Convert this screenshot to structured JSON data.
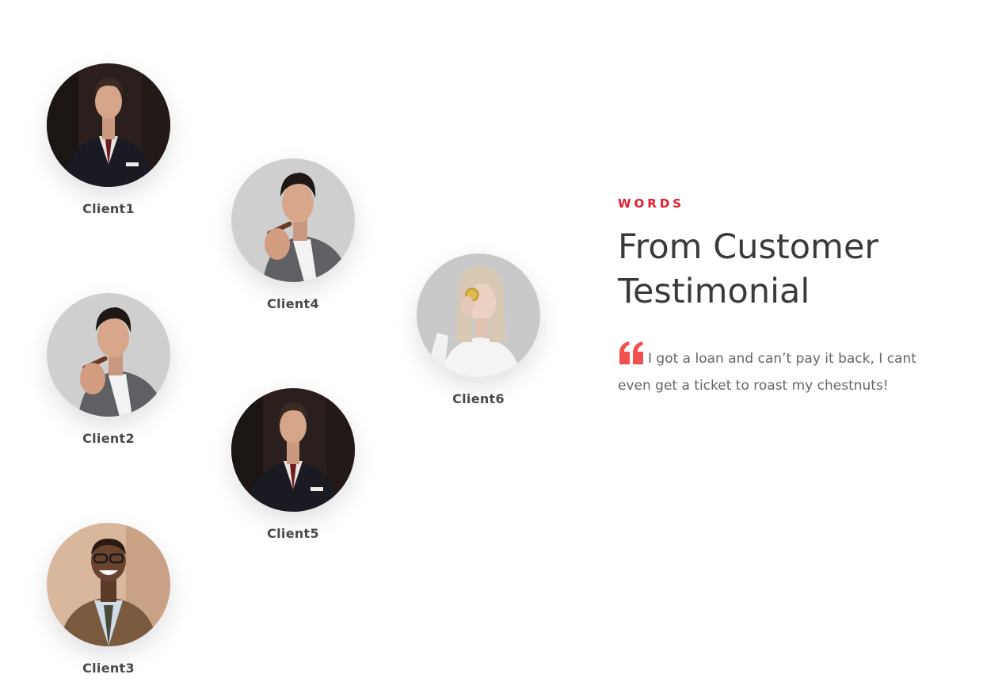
{
  "clients": {
    "c1": {
      "name": "Client1"
    },
    "c2": {
      "name": "Client2"
    },
    "c3": {
      "name": "Client3"
    },
    "c4": {
      "name": "Client4"
    },
    "c5": {
      "name": "Client5"
    },
    "c6": {
      "name": "Client6"
    }
  },
  "testimonial": {
    "eyebrow": "WORDS",
    "heading": "From Customer Testimonial",
    "quote": "I got a loan and can’t pay it back, I cant even get a ticket to roast my chestnuts!"
  },
  "colors": {
    "accent": "#e11d2b",
    "quote_icon": "#f0504e",
    "heading": "#3a3a3a",
    "body_text": "#666666"
  },
  "icons": {
    "quote": "quote-icon"
  }
}
